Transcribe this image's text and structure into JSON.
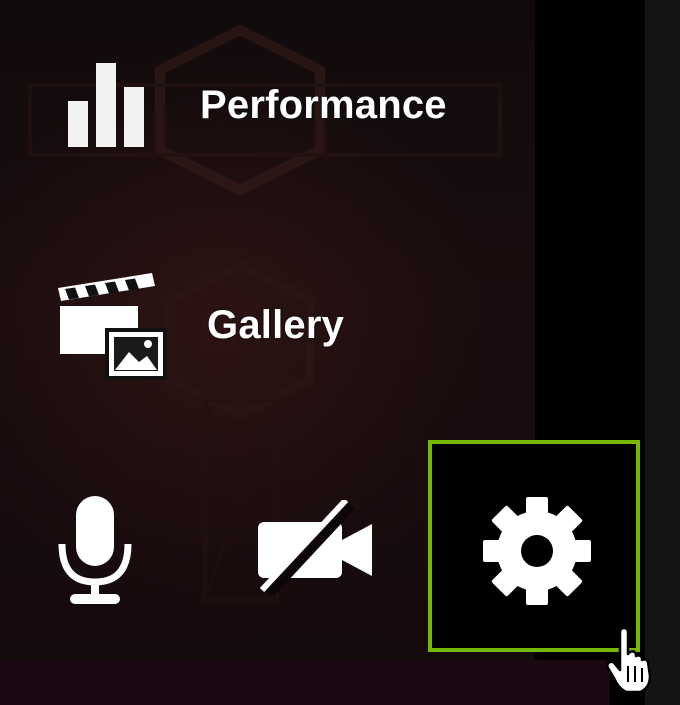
{
  "menu": {
    "performance_label": "Performance",
    "gallery_label": "Gallery"
  },
  "toolbar": {
    "buttons": [
      {
        "icon": "microphone-icon"
      },
      {
        "icon": "camera-off-icon"
      },
      {
        "icon": "gear-icon",
        "state": "hovered"
      }
    ]
  },
  "colors": {
    "accent": "#76b900",
    "text": "#ffffff",
    "background": "#0a0406"
  }
}
